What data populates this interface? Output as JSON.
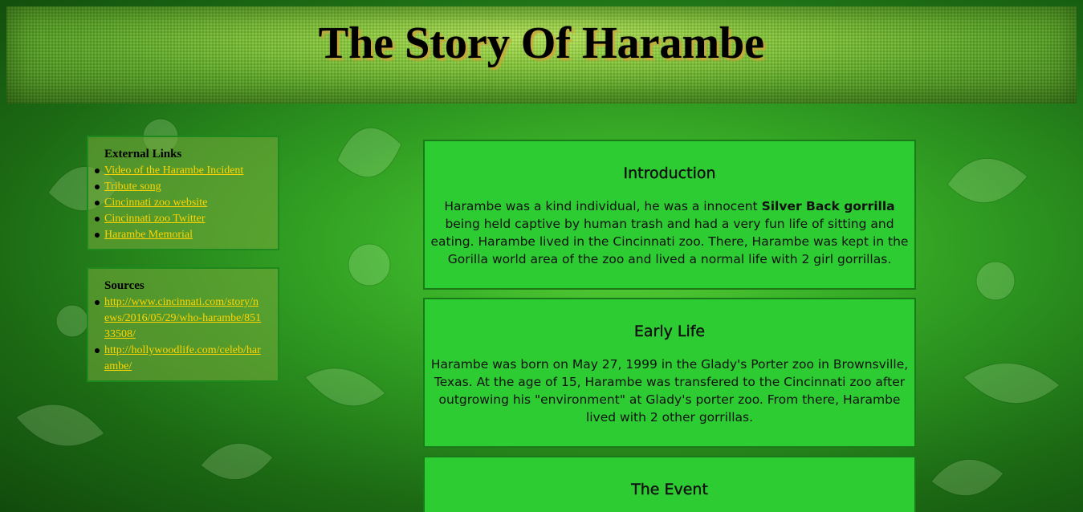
{
  "header": {
    "title": "The Story Of Harambe"
  },
  "sidebar": {
    "external_links": {
      "heading": "External Links",
      "items": [
        {
          "label": "Video of the Harambe Incident"
        },
        {
          "label": "Tribute song"
        },
        {
          "label": "Cincinnati zoo website"
        },
        {
          "label": "Cincinnati zoo Twitter"
        },
        {
          "label": "Harambe Memorial"
        }
      ]
    },
    "sources": {
      "heading": "Sources",
      "items": [
        {
          "label": "http://www.cincinnati.com/story/news/2016/05/29/who-harambe/85133508/"
        },
        {
          "label": "http://hollywoodlife.com/celeb/harambe/"
        }
      ]
    }
  },
  "main": {
    "sections": [
      {
        "title": "Introduction",
        "text_before_bold": "Harambe was a kind individual, he was a innocent ",
        "bold": "Silver Back gorrilla",
        "text_after_bold": " being held captive by human trash and had a very fun life of sitting and eating. Harambe lived in the Cincinnati zoo. There, Harambe was kept in the Gorilla world area of the zoo and lived a normal life with 2 girl gorrillas."
      },
      {
        "title": "Early Life",
        "text": "Harambe was born on May 27, 1999 in the Glady's Porter zoo in Brownsville, Texas. At the age of 15, Harambe was transfered to the Cincinnati zoo after outgrowing his \"environment\" at Glady's porter zoo. From there, Harambe lived with 2 other gorrillas."
      },
      {
        "title": "The Event"
      }
    ]
  },
  "colors": {
    "link": "#ffd400",
    "card_bg": "#2ecc33",
    "card_border": "#1a7a1a"
  }
}
